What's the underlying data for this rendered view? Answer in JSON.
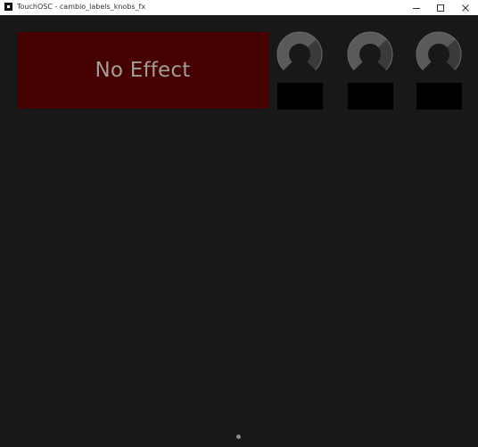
{
  "window": {
    "title": "TouchOSC - cambio_labels_knobs_fx",
    "controls": {
      "minimize_icon": "minimize-icon",
      "maximize_icon": "maximize-icon",
      "close_icon": "close-icon"
    }
  },
  "layout": {
    "effect_button": {
      "label": "No Effect",
      "color": "#450000",
      "label_color": "#a39c99"
    },
    "knobs": [
      {
        "name": "knob-1",
        "value": 0.68
      },
      {
        "name": "knob-2",
        "value": 0.68
      },
      {
        "name": "knob-3",
        "value": 0.68
      }
    ],
    "value_labels": [
      "",
      "",
      ""
    ]
  },
  "pager": {
    "pages": 1,
    "current": 1
  },
  "colors": {
    "background": "#181818",
    "knob_fill": "#5a5a5a",
    "knob_track": "#3a3a3a",
    "value_box": "#000000"
  }
}
